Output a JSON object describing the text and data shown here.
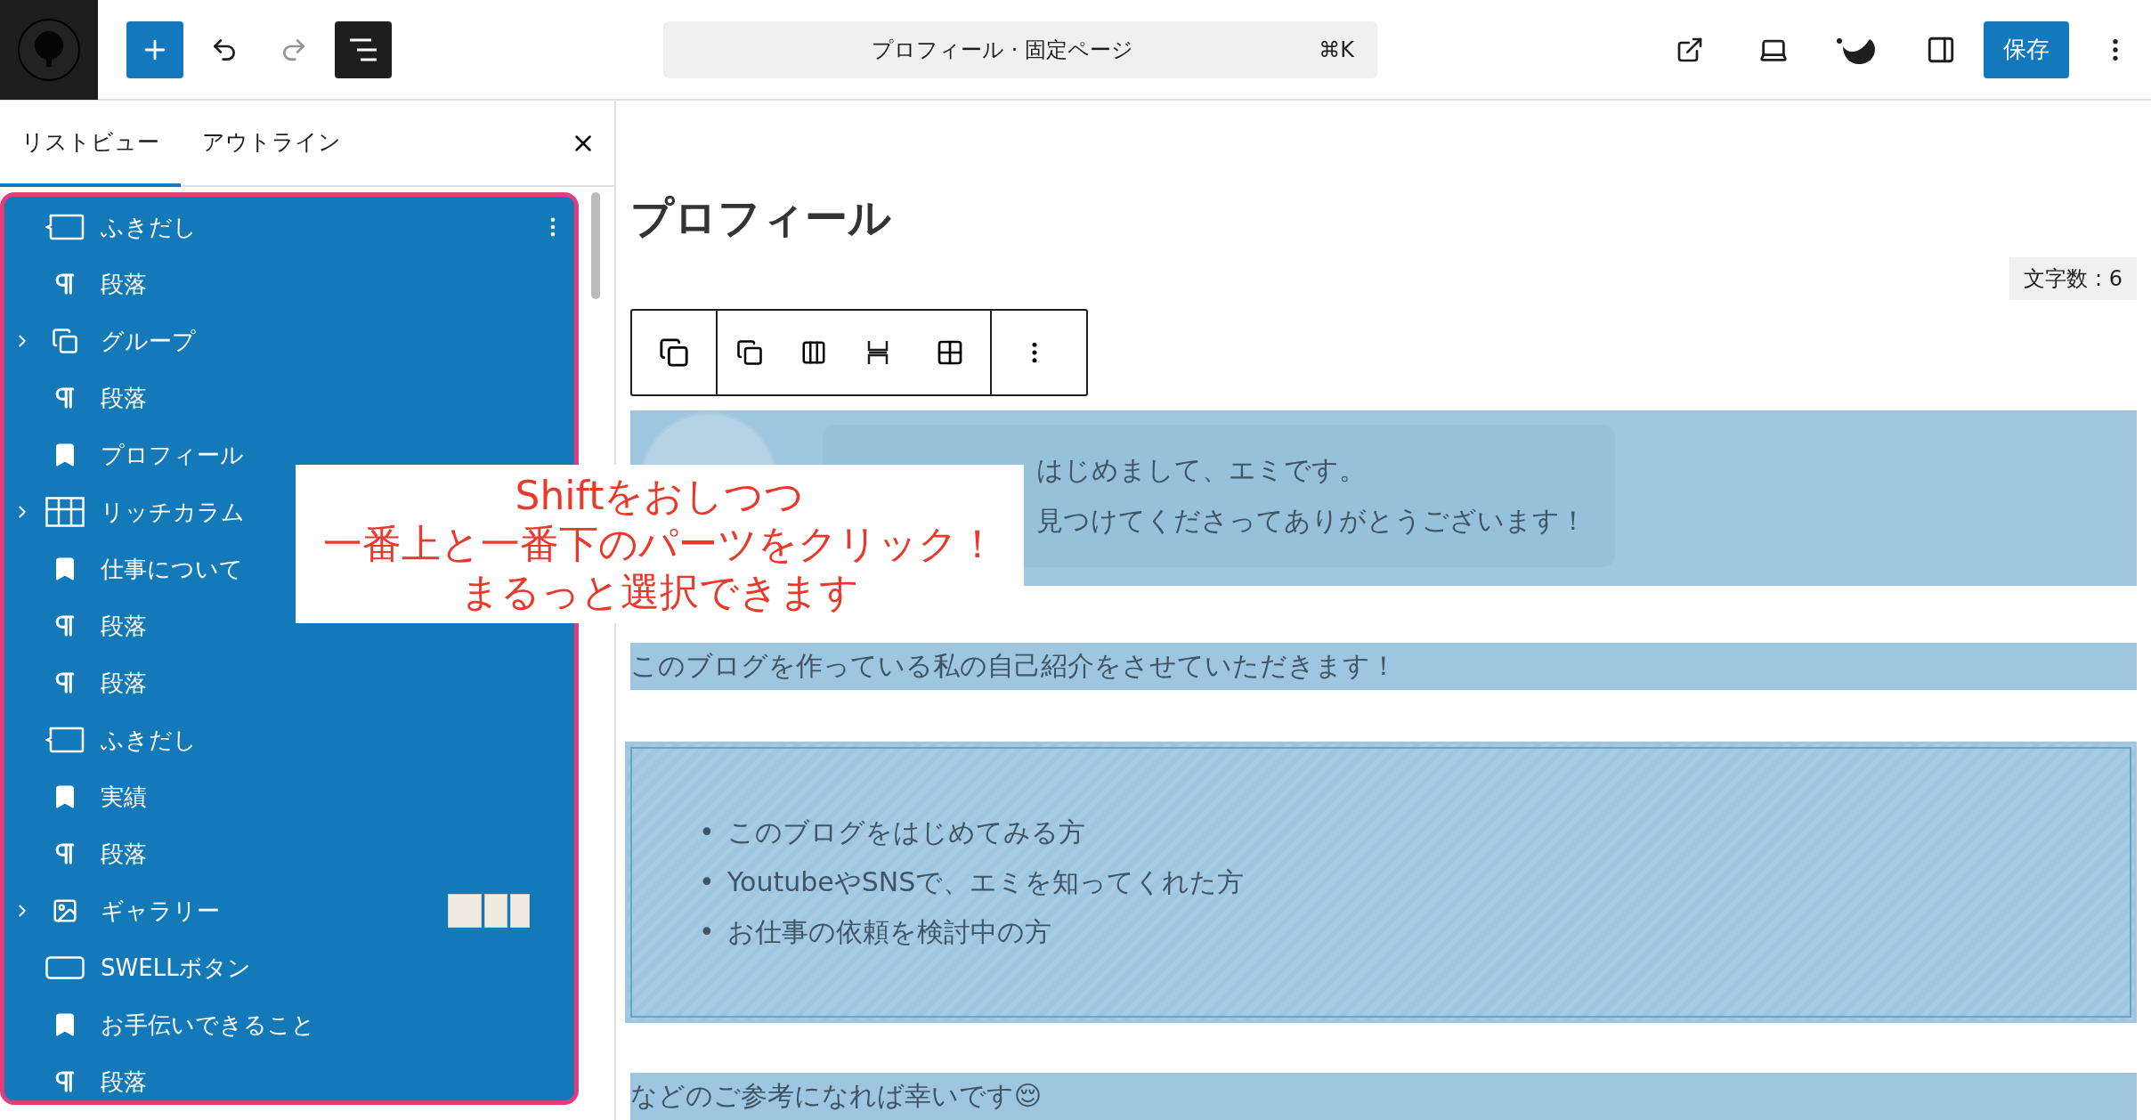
{
  "header": {
    "command": {
      "title": "プロフィール · 固定ページ",
      "shortcut": "⌘K"
    },
    "save": "保存"
  },
  "list_panel": {
    "tabs": [
      {
        "label": "リストビュー",
        "selected": true
      },
      {
        "label": "アウトライン",
        "selected": false
      }
    ],
    "items": [
      {
        "label": "ふきだし",
        "kind": "bubble",
        "expandable": false,
        "selected": true,
        "thumbnails": false,
        "menu": true
      },
      {
        "label": "段落",
        "kind": "paragraph",
        "expandable": false,
        "selected": true,
        "thumbnails": false,
        "menu": false
      },
      {
        "label": "グループ",
        "kind": "group",
        "expandable": true,
        "selected": true,
        "thumbnails": false,
        "menu": false
      },
      {
        "label": "段落",
        "kind": "paragraph",
        "expandable": false,
        "selected": true,
        "thumbnails": false,
        "menu": false
      },
      {
        "label": "プロフィール",
        "kind": "bookmark",
        "expandable": false,
        "selected": true,
        "thumbnails": false,
        "menu": false
      },
      {
        "label": "リッチカラム",
        "kind": "columns",
        "expandable": true,
        "selected": true,
        "thumbnails": false,
        "menu": false
      },
      {
        "label": "仕事について",
        "kind": "bookmark",
        "expandable": false,
        "selected": true,
        "thumbnails": false,
        "menu": false
      },
      {
        "label": "段落",
        "kind": "paragraph",
        "expandable": false,
        "selected": true,
        "thumbnails": false,
        "menu": false
      },
      {
        "label": "段落",
        "kind": "paragraph",
        "expandable": false,
        "selected": true,
        "thumbnails": false,
        "menu": false
      },
      {
        "label": "ふきだし",
        "kind": "bubble",
        "expandable": false,
        "selected": true,
        "thumbnails": false,
        "menu": false
      },
      {
        "label": "実績",
        "kind": "bookmark",
        "expandable": false,
        "selected": true,
        "thumbnails": false,
        "menu": false
      },
      {
        "label": "段落",
        "kind": "paragraph",
        "expandable": false,
        "selected": true,
        "thumbnails": false,
        "menu": false
      },
      {
        "label": "ギャラリー",
        "kind": "gallery",
        "expandable": true,
        "selected": true,
        "thumbnails": true,
        "menu": false
      },
      {
        "label": "SWELLボタン",
        "kind": "button",
        "expandable": false,
        "selected": true,
        "thumbnails": false,
        "menu": false
      },
      {
        "label": "お手伝いできること",
        "kind": "bookmark",
        "expandable": false,
        "selected": true,
        "thumbnails": false,
        "menu": false
      },
      {
        "label": "段落",
        "kind": "paragraph",
        "expandable": false,
        "selected": true,
        "thumbnails": false,
        "menu": false
      }
    ]
  },
  "editor": {
    "title": "プロフィール",
    "word_count": "文字数 : 6",
    "bubble": {
      "lines": [
        "はじめまして、エミです。",
        "見つけてくださってありがとうございます！"
      ]
    },
    "paragraph": "このブログを作っている私の自己紹介をさせていただきます！",
    "list_items": [
      {
        "bullet": "•",
        "text": "このブログをはじめてみる方"
      },
      {
        "bullet": "•",
        "text": "YoutubeやSNSで、エミを知ってくれた方"
      },
      {
        "bullet": "•",
        "text": "お仕事の依頼を検討中の方"
      }
    ],
    "closing": "などのご参考になれば幸いです😌"
  },
  "annotation": {
    "lines": [
      "Shiftをおしつつ",
      "一番上と一番下のパーツをクリック！",
      "まるっと選択できます"
    ]
  }
}
